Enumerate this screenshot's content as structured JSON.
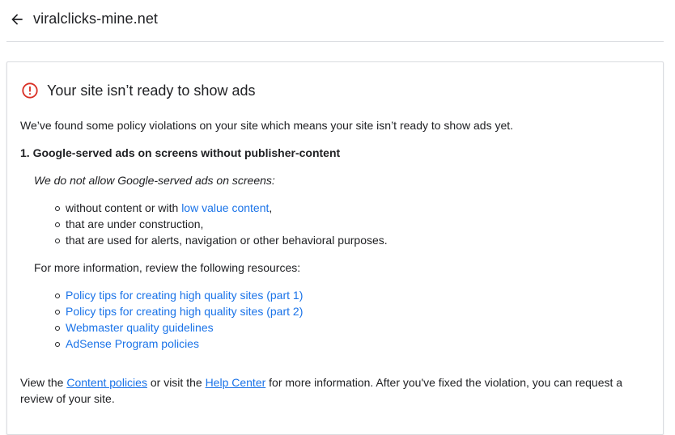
{
  "header": {
    "title": "viralclicks-mine.net",
    "back_icon": "arrow-back-icon"
  },
  "card": {
    "alert_icon": "error-circle-icon",
    "alert_color": "#d93025",
    "title": "Your site isn’t ready to show ads",
    "intro": "We’ve found some policy violations on your site which means your site isn’t ready to show ads yet.",
    "section_heading": "1. Google-served ads on screens without publisher-content",
    "policy_intro": "We do not allow Google-served ads on screens:",
    "bullets": {
      "b1_prefix": "without content or with ",
      "b1_link": "low value content",
      "b1_suffix": ",",
      "b2": "that are under construction,",
      "b3": "that are used for alerts, navigation or other behavioral purposes."
    },
    "more_info": "For more information, review the following resources:",
    "resources": [
      "Policy tips for creating high quality sites (part 1)",
      "Policy tips for creating high quality sites (part 2)",
      "Webmaster quality guidelines",
      "AdSense Program policies"
    ],
    "footer": {
      "part1": "View the ",
      "link1": "Content policies",
      "part2": " or visit the ",
      "link2": "Help Center",
      "part3": " for more information. After you've fixed the violation, you can request a review of your site."
    }
  },
  "colors": {
    "link": "#1a73e8",
    "text": "#202124",
    "divider": "#dadce0"
  }
}
